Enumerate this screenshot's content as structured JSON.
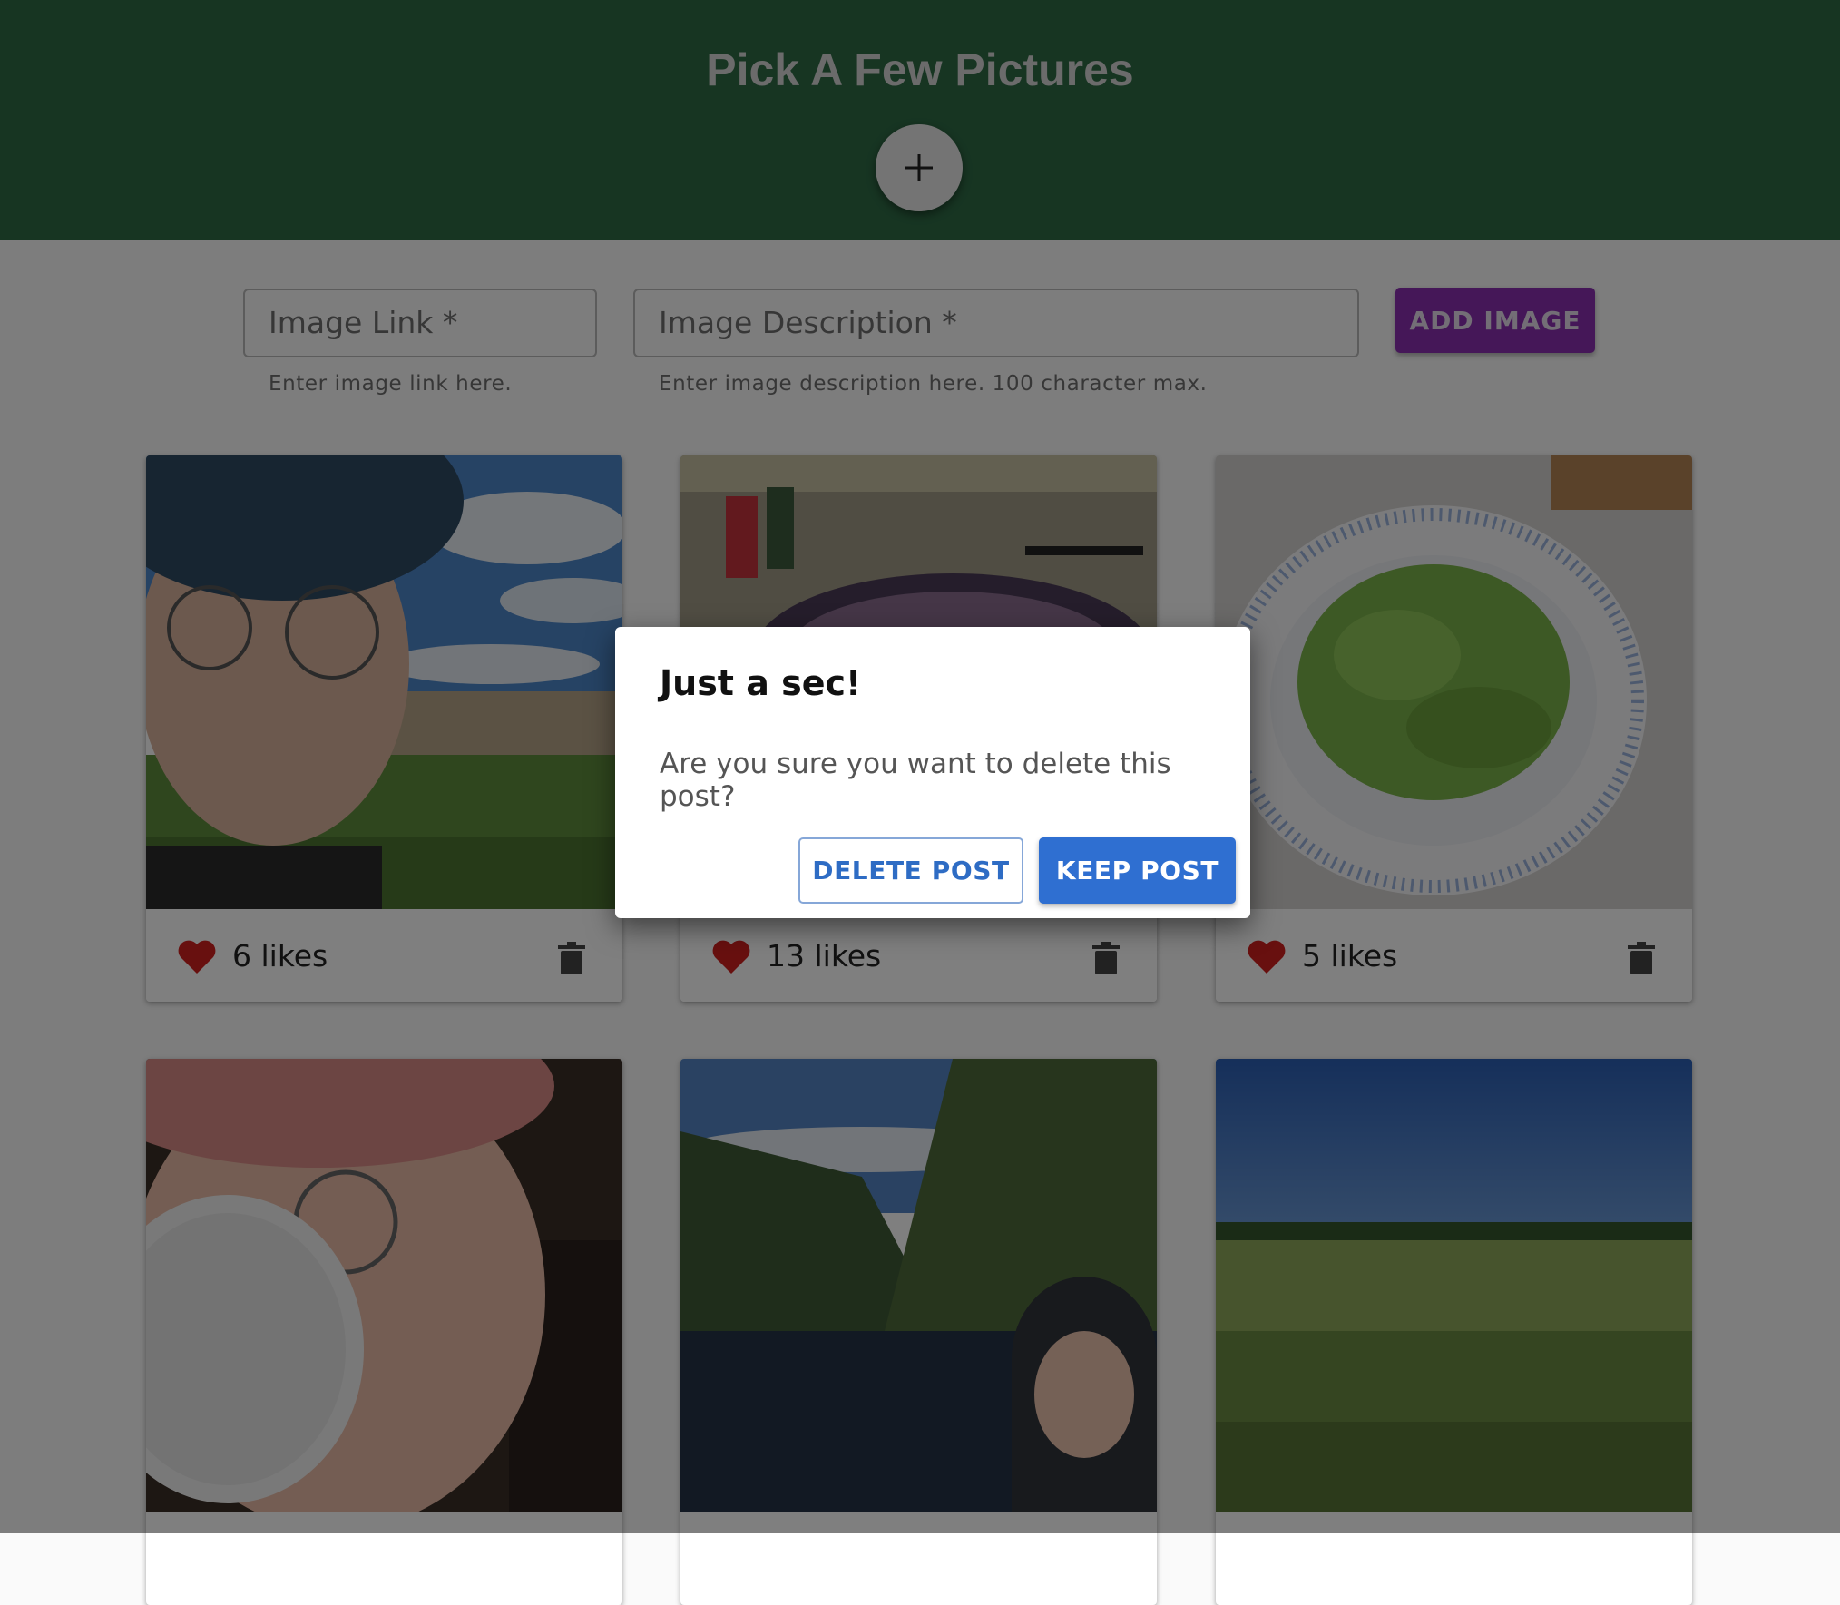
{
  "header": {
    "title": "Pick A Few Pictures",
    "add_button_icon": "plus-icon"
  },
  "form": {
    "image_link_label": "Image Link *",
    "image_link_helper": "Enter image link here.",
    "image_description_label": "Image Description *",
    "image_description_helper": "Enter image description here. 100 character max.",
    "add_button_label": "ADD IMAGE"
  },
  "posts": [
    {
      "likes": "6 likes"
    },
    {
      "likes": "13 likes"
    },
    {
      "likes": "5 likes"
    },
    {
      "likes": ""
    },
    {
      "likes": ""
    },
    {
      "likes": ""
    }
  ],
  "dialog": {
    "title": "Just a sec!",
    "message": "Are you sure you want to delete this post?",
    "delete_label": "DELETE POST",
    "keep_label": "KEEP POST"
  },
  "colors": {
    "header": "#2e6a45",
    "accent_purple": "#8b2fb0",
    "primary_blue": "#2f6fd1",
    "heart_red": "#d0201f"
  }
}
